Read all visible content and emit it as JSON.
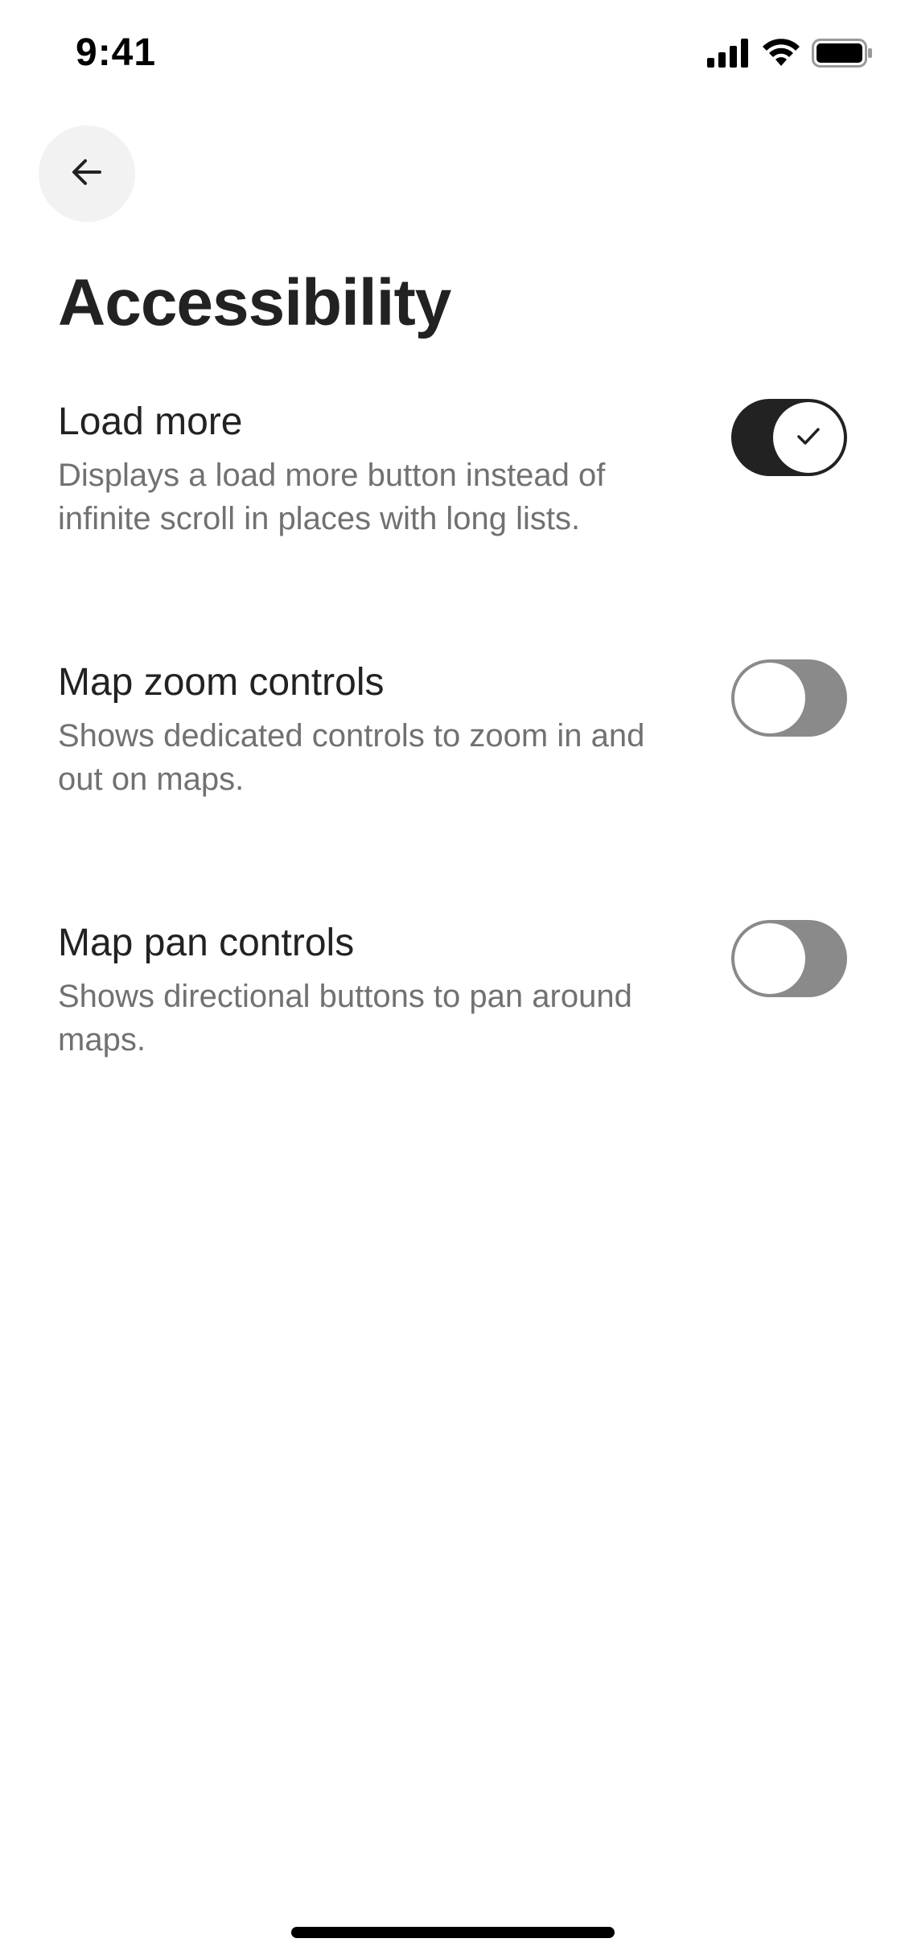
{
  "status_bar": {
    "time": "9:41",
    "icons": [
      "signal-icon",
      "wifi-icon",
      "battery-icon"
    ]
  },
  "header": {
    "back_icon": "arrow-left-icon",
    "title": "Accessibility"
  },
  "settings": [
    {
      "label": "Load more",
      "description": "Displays a load more button instead of infinite scroll in places with long lists.",
      "enabled": true
    },
    {
      "label": "Map zoom controls",
      "description": "Shows dedicated controls to zoom in and out on maps.",
      "enabled": false
    },
    {
      "label": "Map pan controls",
      "description": "Shows directional buttons to pan around maps.",
      "enabled": false
    }
  ],
  "colors": {
    "toggle_on": "#222222",
    "toggle_off": "#8a8a8a",
    "text_primary": "#222222",
    "text_secondary": "#717171",
    "back_button_bg": "#f2f2f2"
  }
}
